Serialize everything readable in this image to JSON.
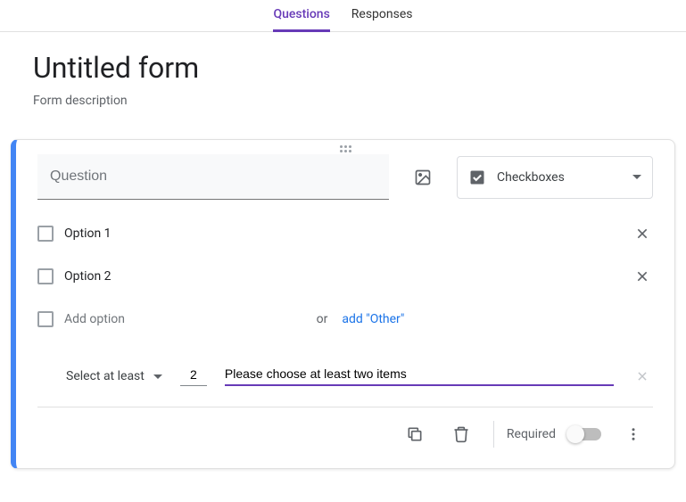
{
  "tabs": {
    "questions": "Questions",
    "responses": "Responses"
  },
  "header": {
    "title": "Untitled form",
    "description": "Form description"
  },
  "question": {
    "placeholder": "Question",
    "type_label": "Checkboxes",
    "options": [
      {
        "label": "Option 1"
      },
      {
        "label": "Option 2"
      }
    ],
    "add_option_label": "Add option",
    "or_text": "or",
    "add_other_label": "add \"Other\"",
    "validation": {
      "rule_label": "Select at least",
      "number": "2",
      "message": "Please choose at least two items"
    },
    "footer": {
      "required_label": "Required"
    }
  }
}
